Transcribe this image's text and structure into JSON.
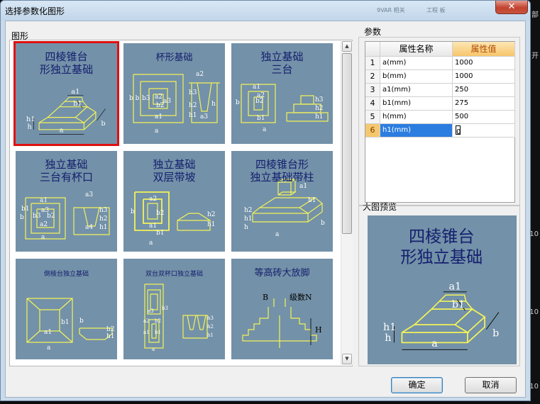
{
  "window": {
    "title": "选择参数化图形",
    "ghost_left": "9VAR 相关",
    "ghost_right": "工程 板"
  },
  "background_app": {
    "fragments": [
      "部",
      "开",
      "10",
      "10",
      "10"
    ]
  },
  "shapes_group": {
    "label": "图形",
    "tiles": [
      {
        "title1": "四棱锥台",
        "title2": "形独立基础",
        "labels": [
          "a1",
          "b1",
          "h1",
          "h",
          "b",
          "a"
        ]
      },
      {
        "title1": "杯形基础",
        "title2": "",
        "labels": [
          "a2",
          "b b",
          "b3",
          "b2",
          "a3",
          "a2",
          "h3",
          "h2",
          "h1",
          "h",
          "a1",
          "a3",
          "a"
        ]
      },
      {
        "title1": "独立基础",
        "title2": "三台",
        "labels": [
          "a2",
          "b2",
          "a1",
          "b1",
          "b",
          "a",
          "h3",
          "h2",
          "h1"
        ]
      },
      {
        "title1": "独立基础",
        "title2": "三台有杯口",
        "labels": [
          "a1",
          "a3",
          "b1",
          "b3",
          "b2",
          "a2",
          "b",
          "a",
          "a3",
          "h3",
          "h2",
          "h1",
          "a4"
        ]
      },
      {
        "title1": "独立基础",
        "title2": "双层带坡",
        "labels": [
          "a2",
          "b2",
          "b",
          "a1",
          "b1",
          "a",
          "h2",
          "h1"
        ]
      },
      {
        "title1": "四棱锥台形",
        "title2": "独立基础带柱",
        "labels": [
          "a1",
          "b1",
          "h2",
          "h1",
          "h",
          "b",
          "a"
        ]
      },
      {
        "title1": "倒棱台独立基础",
        "title2": "",
        "labels": [
          "b1",
          "a1",
          "b",
          "h2",
          "h1",
          "a"
        ]
      },
      {
        "title1": "双台双杯口独立基础",
        "title2": "",
        "labels": [
          "a3",
          "b3",
          "a2",
          "b2",
          "a1",
          "b1",
          "h3",
          "h2",
          "h1",
          "a"
        ]
      },
      {
        "title1": "等高砖大放脚",
        "title2": "",
        "labels": [
          "B",
          "级数N",
          "H"
        ]
      }
    ],
    "selected_index": 0
  },
  "params_group": {
    "label": "参数",
    "col_name": "属性名称",
    "col_value": "属性值",
    "rows": [
      {
        "idx": "1",
        "name": "a(mm)",
        "value": "1000"
      },
      {
        "idx": "2",
        "name": "b(mm)",
        "value": "1000"
      },
      {
        "idx": "3",
        "name": "a1(mm)",
        "value": "250"
      },
      {
        "idx": "4",
        "name": "b1(mm)",
        "value": "275"
      },
      {
        "idx": "5",
        "name": "h(mm)",
        "value": "500"
      },
      {
        "idx": "6",
        "name": "h1(mm)",
        "value": "0"
      }
    ],
    "active_row": 5
  },
  "preview_group": {
    "label": "大图预览",
    "title1": "四棱锥台",
    "title2": "形独立基础",
    "labels": [
      "a1",
      "b1",
      "h1",
      "h",
      "b",
      "a"
    ]
  },
  "buttons": {
    "ok": "确定",
    "cancel": "取消"
  },
  "colors": {
    "tile_bg": "#7391a8",
    "line": "#f3f35a",
    "title": "#15206e",
    "selected": "#e01010"
  }
}
